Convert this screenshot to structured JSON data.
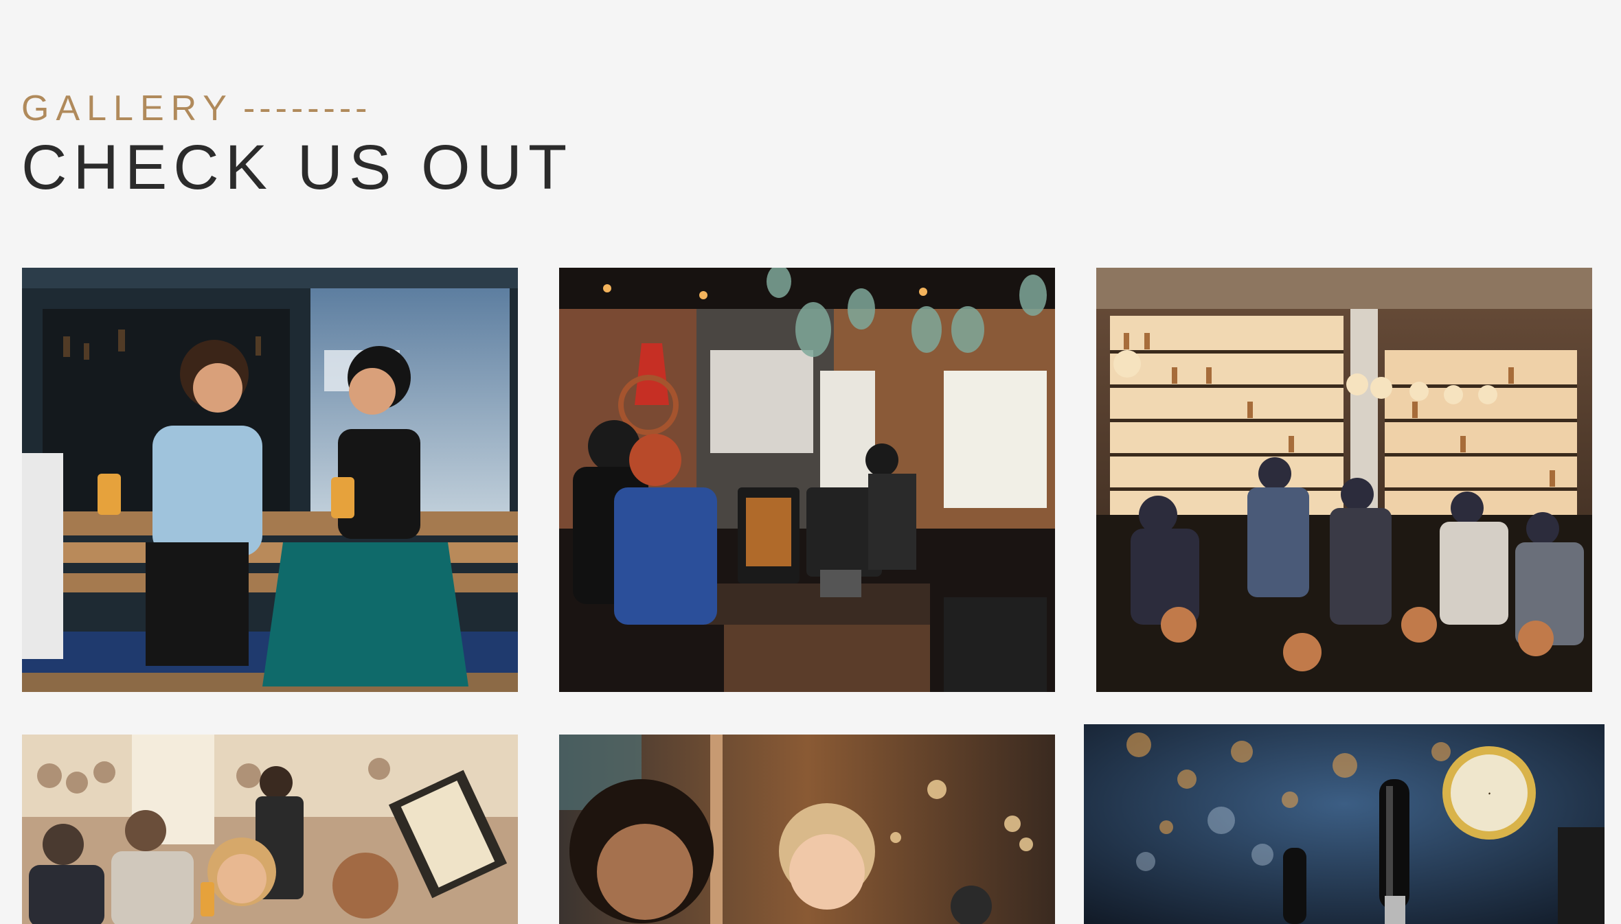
{
  "section": {
    "eyebrow": "GALLERY",
    "eyebrow_dashes": "--------",
    "title": "CHECK US OUT"
  },
  "colors": {
    "background": "#f5f5f5",
    "eyebrow": "#b08a5b",
    "title": "#2b2b2b"
  },
  "gallery": {
    "images": [
      {
        "name": "friends-laughing-with-beer-photo"
      },
      {
        "name": "bar-counter-pos-photo"
      },
      {
        "name": "cocktail-bar-shelves-photo"
      },
      {
        "name": "crowded-patio-photo"
      },
      {
        "name": "two-women-smiling-photo"
      },
      {
        "name": "beer-tap-handles-photo"
      }
    ]
  }
}
